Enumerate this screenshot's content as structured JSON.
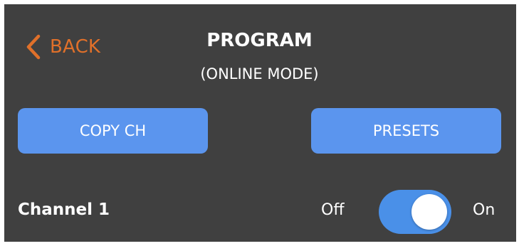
{
  "header": {
    "back_label": "BACK",
    "title": "PROGRAM",
    "subtitle": "(ONLINE MODE)"
  },
  "actions": {
    "copy_label": "COPY CH",
    "presets_label": "PRESETS"
  },
  "channel": {
    "label": "Channel 1",
    "off_label": "Off",
    "on_label": "On",
    "enabled": true
  },
  "colors": {
    "background": "#404040",
    "accent": "#e0702a",
    "button": "#5b95ee",
    "toggle_on": "#4a90e8",
    "text": "#ffffff"
  },
  "icons": {
    "back": "chevron-left-icon"
  }
}
